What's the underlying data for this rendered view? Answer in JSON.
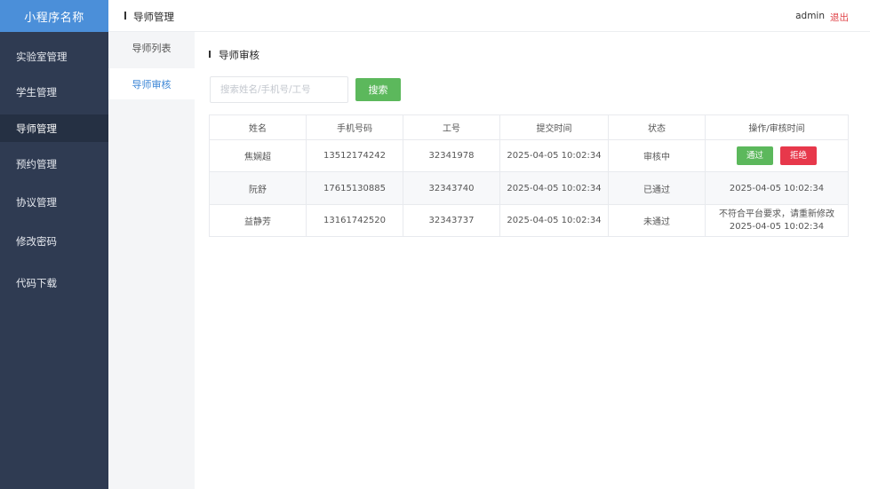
{
  "app": {
    "brand": "小程序名称"
  },
  "sidebar": {
    "items": [
      {
        "label": "实验室管理",
        "active": false
      },
      {
        "label": "学生管理",
        "active": false
      },
      {
        "label": "导师管理",
        "active": true
      },
      {
        "label": "预约管理",
        "active": false
      },
      {
        "label": "协议管理",
        "active": false
      },
      {
        "label": "修改密码",
        "active": false
      },
      {
        "label": "代码下载",
        "active": false
      }
    ]
  },
  "header": {
    "title": "导师管理",
    "user": "admin",
    "logout": "退出"
  },
  "subnav": {
    "items": [
      {
        "label": "导师列表",
        "active": false
      },
      {
        "label": "导师审核",
        "active": true
      }
    ]
  },
  "main": {
    "section_title": "导师审核",
    "search": {
      "placeholder": "搜索姓名/手机号/工号",
      "value": "",
      "button": "搜索"
    },
    "table": {
      "headers": [
        "姓名",
        "手机号码",
        "工号",
        "提交时间",
        "状态",
        "操作/审核时间"
      ],
      "rows": [
        {
          "name": "焦娴超",
          "phone": "13512174242",
          "id": "32341978",
          "submitted": "2025-04-05  10:02:34",
          "status": "审核中",
          "approve_label": "通过",
          "reject_label": "拒绝"
        },
        {
          "name": "阮舒",
          "phone": "17615130885",
          "id": "32343740",
          "submitted": "2025-04-05  10:02:34",
          "status": "已通过",
          "review_time": "2025-04-05  10:02:34"
        },
        {
          "name": "益静芳",
          "phone": "13161742520",
          "id": "32343737",
          "submitted": "2025-04-05  10:02:34",
          "status": "未通过",
          "reason": "不符合平台要求，请重新修改",
          "review_time": "2025-04-05  10:02:34"
        }
      ]
    }
  },
  "colors": {
    "sidebar_bg": "#2f3b52",
    "brand_bg": "#4b8fd9",
    "accent_green": "#5cb85c",
    "accent_red": "#e7384b",
    "status_pending": "#f0a020",
    "status_pass": "#28b463",
    "status_reject": "#e0454a",
    "link_blue": "#3b86d6"
  }
}
